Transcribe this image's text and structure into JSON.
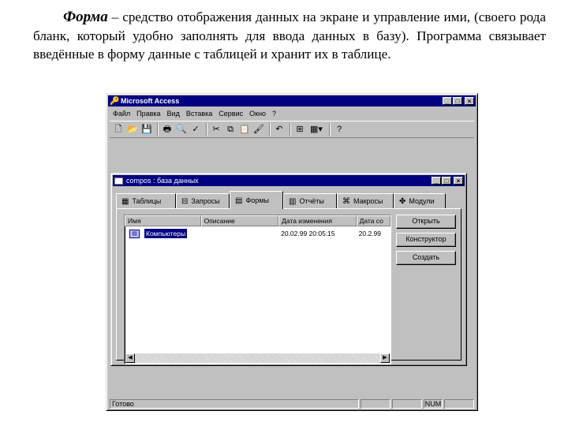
{
  "intro": {
    "term": "Форма",
    "body": " – средство отображения данных на экране и управление ими, (своего рода бланк, который удобно заполнять для ввода данных в базу). Программа связывает введённые в форму данные с таблицей и хранит их в таблице."
  },
  "app": {
    "title": "Microsoft Access",
    "controls": [
      "_",
      "□",
      "×"
    ],
    "menu": [
      "Файл",
      "Правка",
      "Вид",
      "Вставка",
      "Сервис",
      "Окно",
      "?"
    ],
    "toolbar_icons": [
      "new-icon",
      "open-icon",
      "save-icon",
      "print-icon",
      "preview-icon",
      "spell-icon",
      "cut-icon",
      "copy-icon",
      "paste-icon",
      "format-painter-icon",
      "undo-icon",
      "relationships-icon",
      "new-object-icon",
      "help-icon"
    ],
    "status": {
      "text": "Готово",
      "num": "NUM"
    }
  },
  "db": {
    "title": "compos : база данных",
    "tabs": [
      {
        "label": "Таблицы",
        "icon": "table-icon"
      },
      {
        "label": "Запросы",
        "icon": "query-icon"
      },
      {
        "label": "Формы",
        "icon": "form-icon"
      },
      {
        "label": "Отчёты",
        "icon": "report-icon"
      },
      {
        "label": "Макросы",
        "icon": "macro-icon"
      },
      {
        "label": "Модули",
        "icon": "module-icon"
      }
    ],
    "active_tab": "Формы",
    "columns": [
      "Имя",
      "Описание",
      "Дата изменения",
      "Дата со"
    ],
    "rows": [
      {
        "name": "Компьютеры",
        "description": "",
        "modified": "20.02.99 20:05:15",
        "created": "20.2.99"
      }
    ],
    "buttons": {
      "open": "Открыть",
      "design": "Конструктор",
      "create": "Создать"
    }
  }
}
